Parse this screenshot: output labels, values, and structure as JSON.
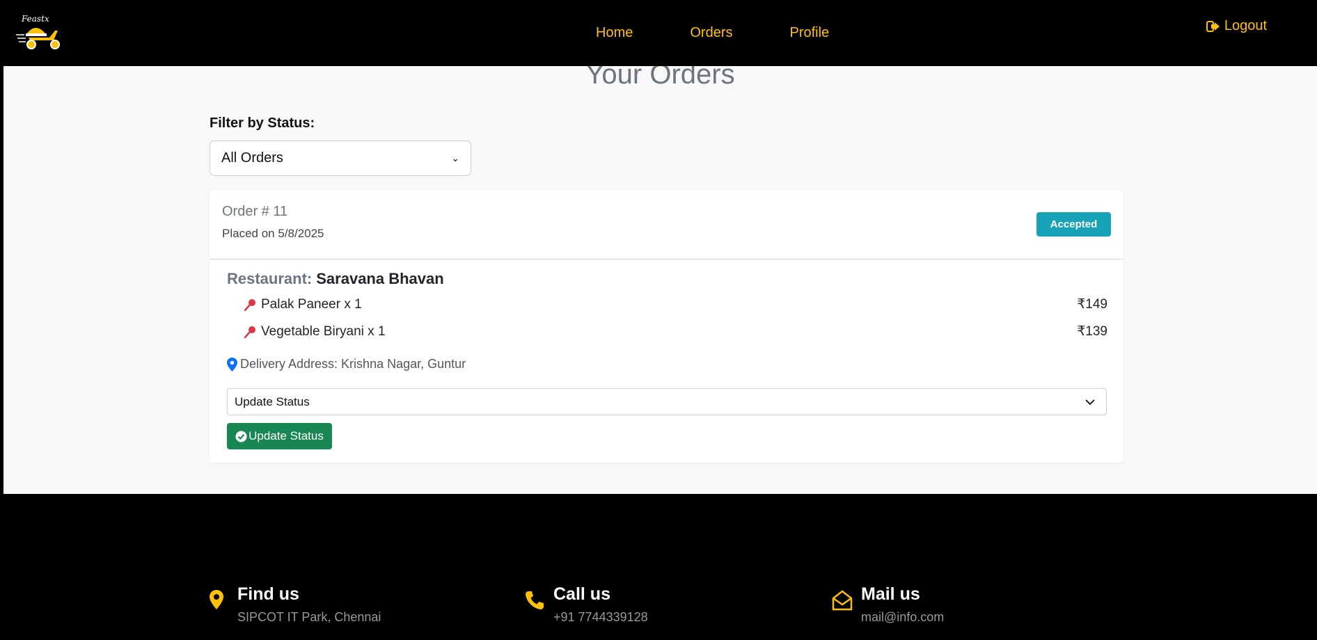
{
  "nav": {
    "links": [
      "Home",
      "Orders",
      "Profile"
    ],
    "logout": "Logout",
    "logo_text": "Feastx"
  },
  "main": {
    "title": "Your Orders",
    "filter_label": "Filter by Status:",
    "filter_value": "All Orders"
  },
  "order": {
    "number": "Order # 11",
    "placed": "Placed on 5/8/2025",
    "status": "Accepted",
    "restaurant_label": "Restaurant:",
    "restaurant_name": "Saravana Bhavan",
    "items": [
      {
        "name": "Palak Paneer x 1",
        "price": "₹149"
      },
      {
        "name": "Vegetable Biryani x 1",
        "price": "₹139"
      }
    ],
    "address": "Delivery Address: Krishna Nagar, Guntur",
    "update_select": "Update Status",
    "update_button": "Update Status"
  },
  "footer": {
    "find_title": "Find us",
    "find_text": "SIPCOT IT Park, Chennai",
    "call_title": "Call us",
    "call_text": "+91 7744339128",
    "mail_title": "Mail us",
    "mail_text": "mail@info.com"
  },
  "colors": {
    "accent": "#ffc107",
    "badge": "#17a2b8",
    "button": "#198754",
    "pin": "#dc3545",
    "location": "#0d6efd"
  }
}
